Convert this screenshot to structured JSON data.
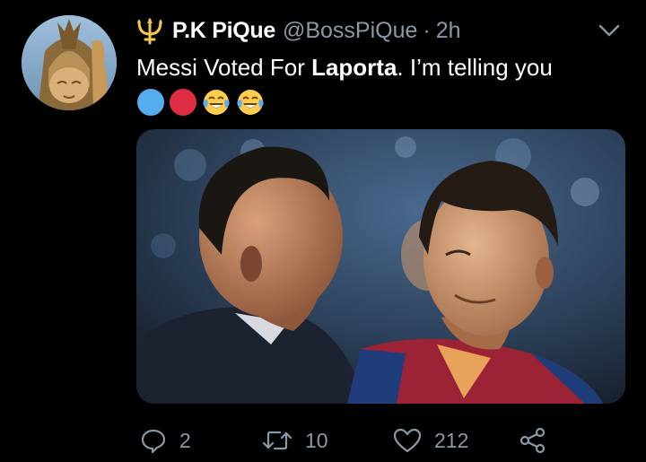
{
  "tweet": {
    "display_name": "P.K PiQue",
    "handle": "@BossPiQue",
    "separator": "·",
    "timestamp": "2h",
    "text_before": "Messi Voted For ",
    "text_bold": "Laporta",
    "text_after": ". I’m telling you",
    "emojis": [
      "blue-circle",
      "red-circle",
      "joy-face",
      "joy-face"
    ]
  },
  "actions": {
    "reply_count": "2",
    "retweet_count": "10",
    "like_count": "212"
  },
  "colors": {
    "background": "#000000",
    "secondary_text": "#8899a6",
    "icon_gold": "#f2c94c"
  },
  "icons": {
    "badge": "trident-icon",
    "menu": "chevron-down-icon",
    "reply": "reply-icon",
    "retweet": "retweet-icon",
    "like": "heart-icon",
    "share": "share-icon"
  }
}
